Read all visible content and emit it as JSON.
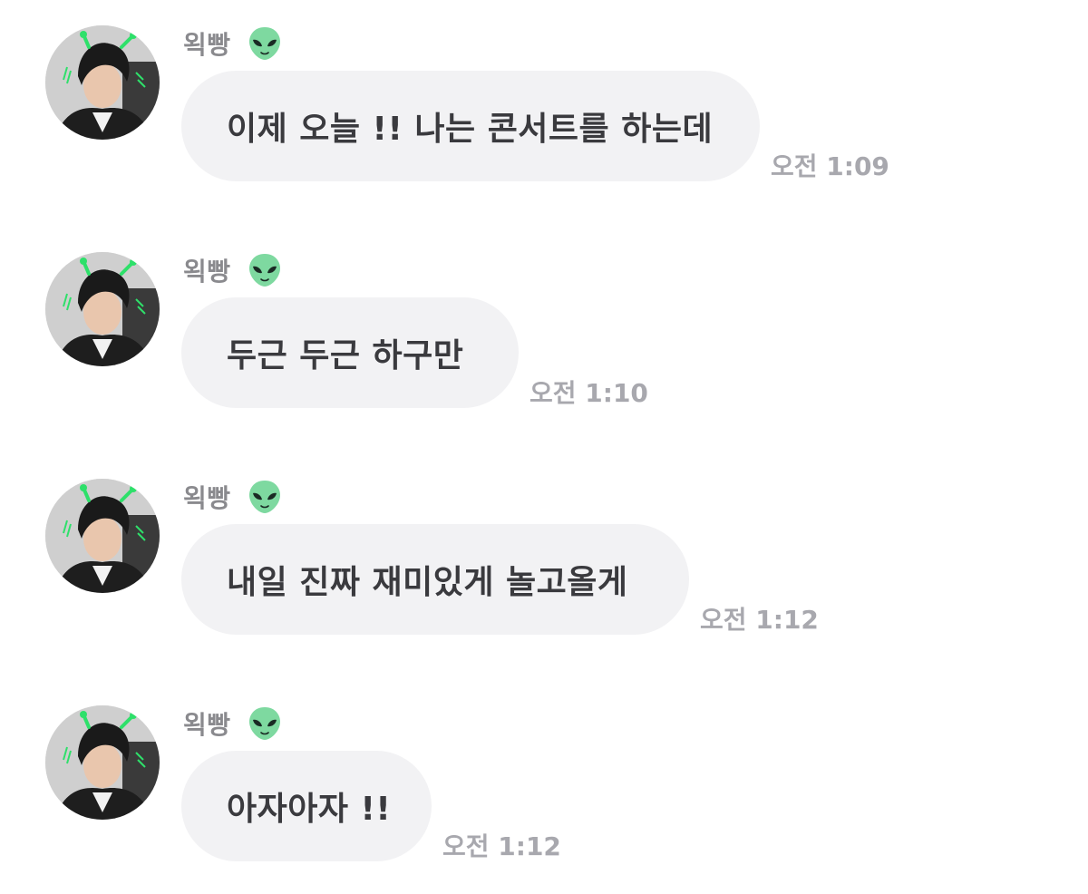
{
  "colors": {
    "background": "#ffffff",
    "bubble": "#f2f2f4",
    "message_text": "#3a3a3e",
    "sender_text": "#8a8a8e",
    "timestamp_text": "#a8a8ae",
    "alien_green": "#7ed9a0"
  },
  "messages": [
    {
      "sender": "왹빵",
      "sender_icon": "alien-icon",
      "avatar_icon": "profile-photo",
      "text": "이제 오늘 !! 나는 콘서트를 하는데",
      "time": "오전 1:09"
    },
    {
      "sender": "왹빵",
      "sender_icon": "alien-icon",
      "avatar_icon": "profile-photo",
      "text": "두근 두근 하구만",
      "time": "오전 1:10"
    },
    {
      "sender": "왹빵",
      "sender_icon": "alien-icon",
      "avatar_icon": "profile-photo",
      "text": "내일 진짜 재미있게 놀고올게",
      "time": "오전 1:12"
    },
    {
      "sender": "왹빵",
      "sender_icon": "alien-icon",
      "avatar_icon": "profile-photo",
      "text": "아자아자 !!",
      "time": "오전 1:12"
    }
  ]
}
